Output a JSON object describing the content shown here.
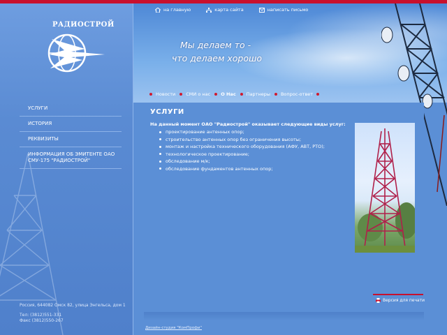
{
  "brand": {
    "logo_text": "РАДИОСТРОЙ"
  },
  "utility_links": [
    {
      "label": "на главную",
      "icon": "home-icon"
    },
    {
      "label": "карта сайта",
      "icon": "sitemap-icon"
    },
    {
      "label": "написать письмо",
      "icon": "mail-icon"
    }
  ],
  "slogan": {
    "line1": "Мы делаем то -",
    "line2": "что делаем хорошо"
  },
  "top_nav": [
    {
      "label": "Новости",
      "active": false
    },
    {
      "label": "СМИ о нас",
      "active": false
    },
    {
      "label": "О Нас",
      "active": true
    },
    {
      "label": "Партнеры",
      "active": false
    },
    {
      "label": "Вопрос-ответ",
      "active": false
    }
  ],
  "left_nav": [
    {
      "label": "УСЛУГИ"
    },
    {
      "label": "ИСТОРИЯ"
    },
    {
      "label": "РЕКВИЗИТЫ"
    },
    {
      "label": "ИНФОРМАЦИЯ ОБ ЭМИТЕНТЕ ОАО СМУ-175 \"РАДИОСТРОЙ\""
    }
  ],
  "contacts": {
    "address": "Россия, 644082 Омск 82, улица Энгельса, дом 1",
    "phone": "Тел: (3812)551-331",
    "fax": "Факс (3812)550-267"
  },
  "content": {
    "title": "УСЛУГИ",
    "intro": "На данный момент ОАО \"Радиострой\" оказывает следующие виды услуг:",
    "services": [
      "проектирование антенных опор;",
      "строительство антенных опор без ограничения высоты;",
      "монтаж и настройка технического оборудования (АФУ, АВТ, РТО);",
      "технологическое проектирование;",
      "обследование м/к;",
      "обследование фундаментов антенных опор;"
    ],
    "print_label": "Версия для печати"
  },
  "footer": {
    "credit": "Дизайн-студия \"КомПрофи\""
  },
  "colors": {
    "accent_red": "#c8102e",
    "background_blue": "#5b8fd6"
  }
}
